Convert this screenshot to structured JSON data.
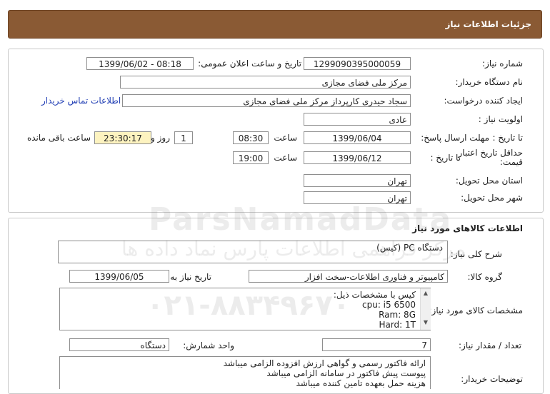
{
  "header": {
    "title": "جزئیات اطلاعات نیاز"
  },
  "need_info": {
    "need_number_label": "شماره نیاز:",
    "need_number": "1299090395000059",
    "announce_label": "تاریخ و ساعت اعلان عمومی:",
    "announce_value": "1399/06/02 - 08:18",
    "buyer_org_label": "نام دستگاه خریدار:",
    "buyer_org": "مرکز ملی فضای مجازی",
    "requester_label": "ایجاد کننده درخواست:",
    "requester": "سجاد حیدری کارپرداز مرکز ملی فضای مجازی",
    "contact_link": "اطلاعات تماس خریدار",
    "priority_label": "اولویت نیاز :",
    "priority": "عادی",
    "deadline_label": "مهلت ارسال پاسخ:",
    "to_date_label": "تا تاریخ :",
    "deadline_date": "1399/06/04",
    "time_label": "ساعت",
    "deadline_time": "08:30",
    "days_value": "1",
    "days_label": "روز و",
    "remaining_time": "23:30:17",
    "remaining_label": "ساعت باقی مانده",
    "price_validity_label": "حداقل تاریخ اعتبار قیمت:",
    "validity_date": "1399/06/12",
    "validity_time": "19:00",
    "province_label": "استان محل تحویل:",
    "province": "تهران",
    "city_label": "شهر محل تحویل:",
    "city": "تهران"
  },
  "goods": {
    "section_title": "اطلاعات کالاهای مورد نیاز",
    "general_desc_label": "شرح کلی نیاز:",
    "general_desc": "دستگاه PC (کیس)",
    "group_label": "گروه کالا:",
    "group": "کامپیوتر و فناوری اطلاعات-سخت افزار",
    "need_date_label": "تاریخ نیاز به کالا:",
    "need_date": "1399/06/05",
    "specs_label": "مشخصات کالای مورد نیاز:",
    "specs_lines": [
      "کیس با مشخصات ذیل:",
      "cpu: i5 6500",
      "Ram: 8G",
      "Hard: 1T"
    ],
    "quantity_label": "تعداد / مقدار نیاز:",
    "quantity": "7",
    "unit_label": "واحد شمارش:",
    "unit": "دستگاه",
    "buyer_notes_label": "توضیحات خریدار:",
    "buyer_notes_lines": [
      "ارائه فاکتور رسمی و گواهی ارزش افزوده الزامی میباشد",
      "پیوست پیش فاکتور در سامانه الزامی میباشد",
      "هزینه حمل بعهده تامین کننده میباشد"
    ]
  },
  "watermark": {
    "brand": "ParsNamadData",
    "persian": "مرکز فراهمی اطلاعات پارس نماد داده ها",
    "phone": "۰۲۱-۸۸۳۴۹۶۷۰"
  }
}
